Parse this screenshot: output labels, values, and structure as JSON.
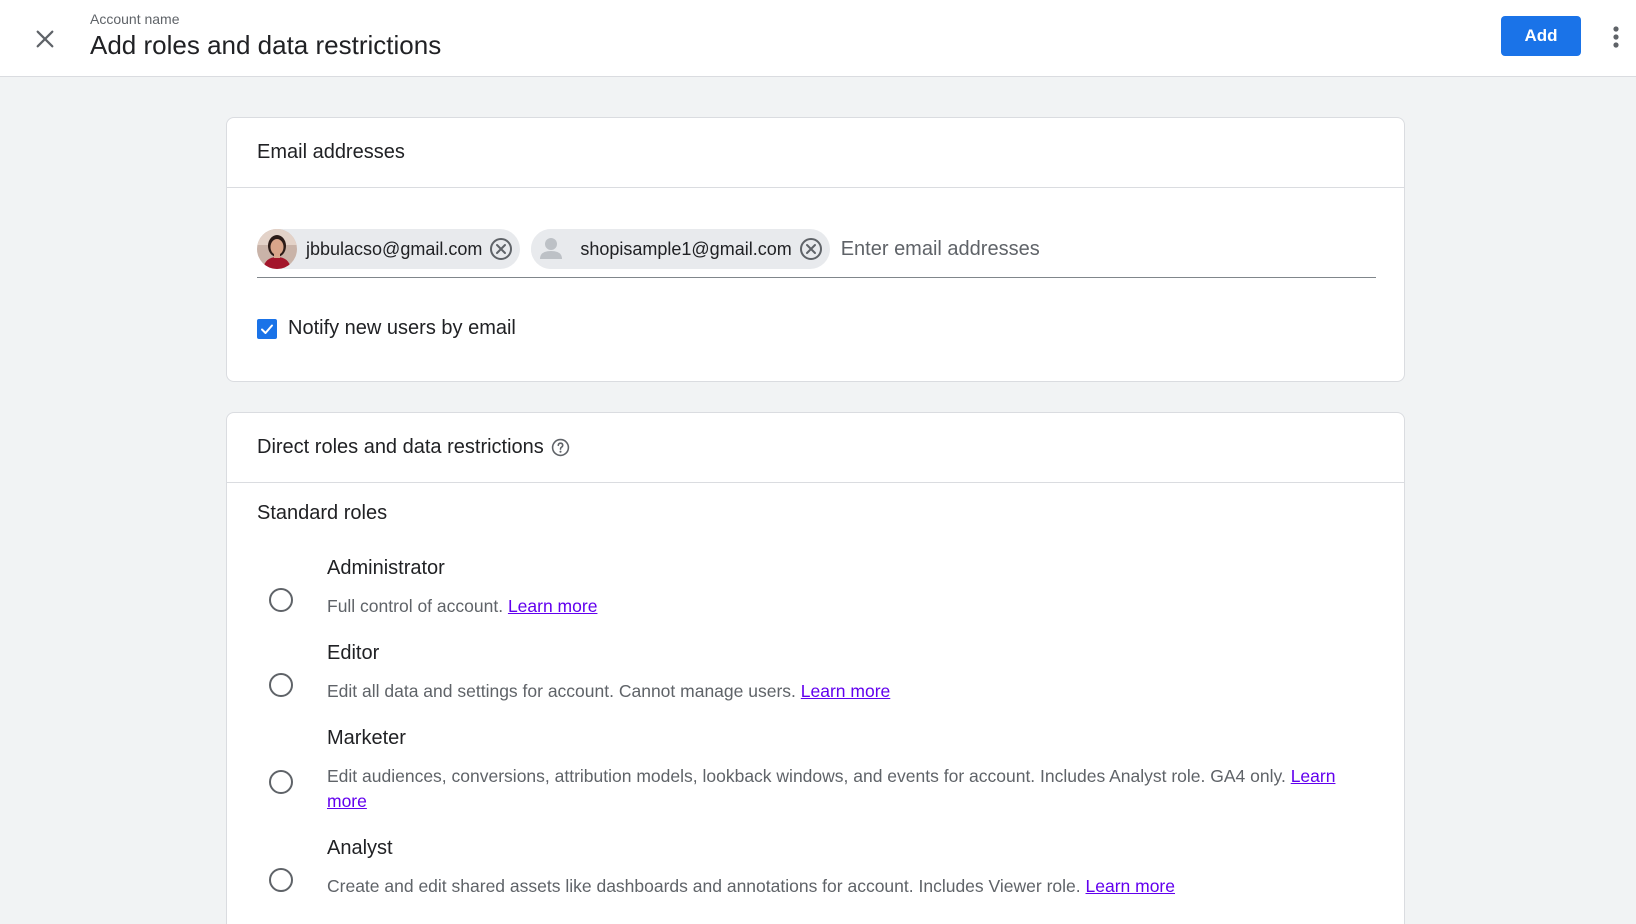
{
  "header": {
    "account_label": "Account name",
    "title": "Add roles and data restrictions",
    "add_label": "Add"
  },
  "email_card": {
    "title": "Email addresses",
    "chips": [
      {
        "email": "jbbulacso@gmail.com",
        "avatar": "photo"
      },
      {
        "email": "shopisample1@gmail.com",
        "avatar": "generic-person"
      }
    ],
    "input_placeholder": "Enter email addresses",
    "notify_label": "Notify new users by email",
    "notify_checked": true
  },
  "roles_card": {
    "title": "Direct roles and data restrictions",
    "section_label": "Standard roles",
    "learn_more": "Learn more",
    "roles": [
      {
        "name": "Administrator",
        "description": "Full control of account."
      },
      {
        "name": "Editor",
        "description": "Edit all data and settings for account. Cannot manage users."
      },
      {
        "name": "Marketer",
        "description": "Edit audiences, conversions, attribution models, lookback windows, and events for account. Includes Analyst role. GA4 only."
      },
      {
        "name": "Analyst",
        "description": "Create and edit shared assets like dashboards and annotations for account. Includes Viewer role."
      }
    ]
  },
  "colors": {
    "primary": "#1a73e8",
    "link": "#6200ee",
    "background": "#f1f3f4"
  },
  "icons": {
    "close": "close-icon",
    "more": "more-vert-icon",
    "chip_remove": "cancel-circle-icon",
    "help": "help-circle-icon",
    "check": "check-icon"
  }
}
